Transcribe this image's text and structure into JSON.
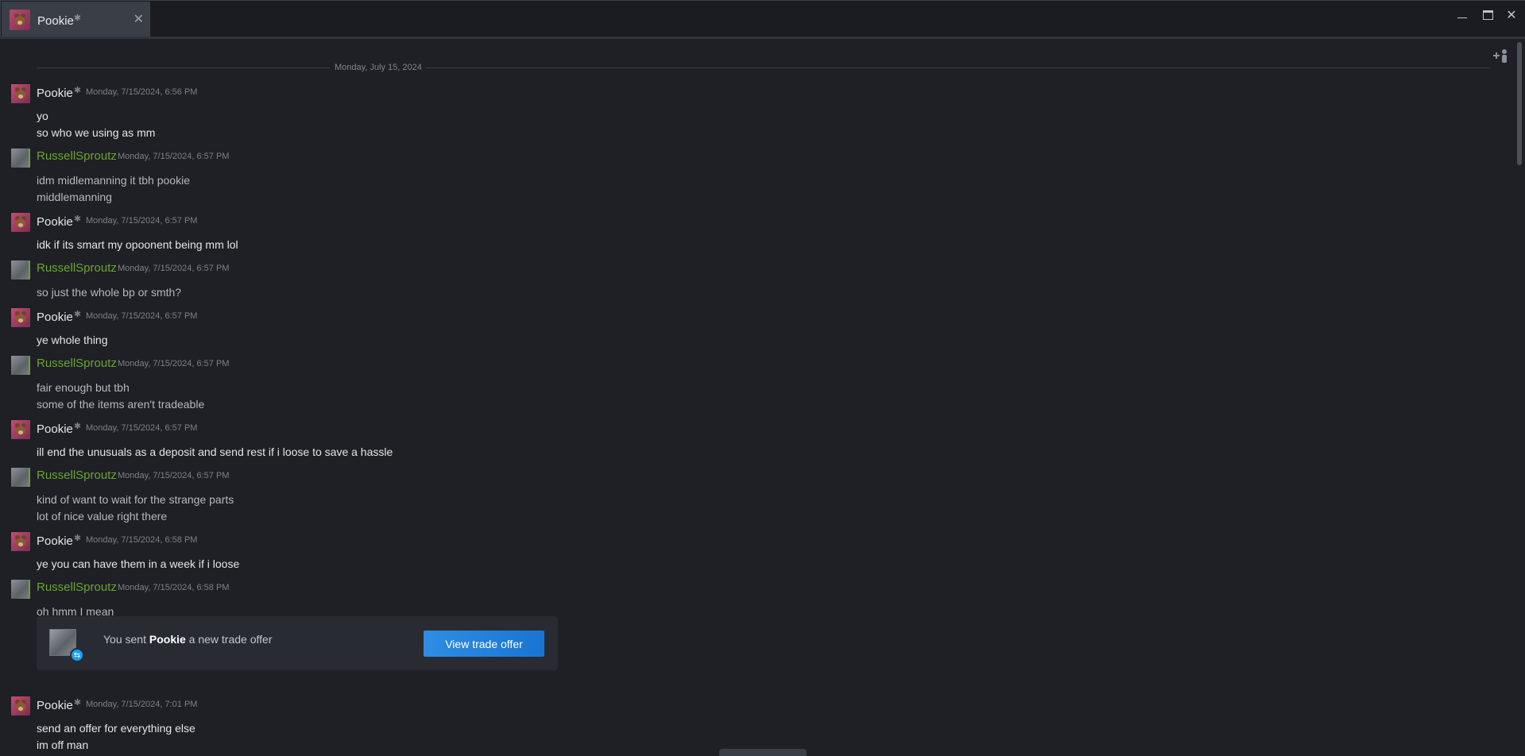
{
  "window": {
    "tab_name": "Pookie",
    "tab_mark": "✱",
    "close_label": "✕",
    "win_close_label": "✕"
  },
  "chat": {
    "date_divider": "Monday, July 15, 2024",
    "messages": [
      {
        "sender": "Pookie",
        "type": "pookie",
        "time": "Monday, 7/15/2024, 6:56 PM",
        "lines": [
          "yo",
          "so who we using as mm"
        ]
      },
      {
        "sender": "RussellSproutz",
        "type": "russell",
        "time": "Monday, 7/15/2024, 6:57 PM",
        "lines": [
          "idm midlemanning it tbh pookie",
          "middlemanning"
        ]
      },
      {
        "sender": "Pookie",
        "type": "pookie",
        "time": "Monday, 7/15/2024, 6:57 PM",
        "lines": [
          "idk if its smart my opoonent being mm lol"
        ]
      },
      {
        "sender": "RussellSproutz",
        "type": "russell",
        "time": "Monday, 7/15/2024, 6:57 PM",
        "lines": [
          "so just the whole bp or smth?"
        ]
      },
      {
        "sender": "Pookie",
        "type": "pookie",
        "time": "Monday, 7/15/2024, 6:57 PM",
        "lines": [
          "ye whole thing"
        ]
      },
      {
        "sender": "RussellSproutz",
        "type": "russell",
        "time": "Monday, 7/15/2024, 6:57 PM",
        "lines": [
          "fair enough but tbh",
          "some of the items aren't tradeable"
        ]
      },
      {
        "sender": "Pookie",
        "type": "pookie",
        "time": "Monday, 7/15/2024, 6:57 PM",
        "lines": [
          "ill end the unusuals as a deposit and send rest if i loose to save a hassle"
        ]
      },
      {
        "sender": "RussellSproutz",
        "type": "russell",
        "time": "Monday, 7/15/2024, 6:57 PM",
        "lines": [
          "kind of want to wait for the strange parts",
          "lot of nice value right there"
        ]
      },
      {
        "sender": "Pookie",
        "type": "pookie",
        "time": "Monday, 7/15/2024, 6:58 PM",
        "lines": [
          "ye you can have them in a week if i loose"
        ]
      },
      {
        "sender": "RussellSproutz",
        "type": "russell",
        "time": "Monday, 7/15/2024, 6:58 PM",
        "lines": [
          "oh hmm I mean"
        ]
      },
      {
        "sender": "Pookie",
        "type": "pookie",
        "time": "Monday, 7/15/2024, 7:01 PM",
        "lines": [
          "send an offer for everything else",
          "im off man"
        ]
      }
    ],
    "trade_offer": {
      "prefix": "You sent",
      "name": "Pookie",
      "suffix": "a new trade offer",
      "button": "View trade offer"
    }
  },
  "colors": {
    "background": "#1e2025",
    "friend_green": "#6aa531",
    "button_blue": "#1a74d2"
  },
  "icons": [
    "minimize-icon",
    "maximize-icon",
    "close-icon",
    "add-friend-icon",
    "bear-avatar-icon",
    "trade-badge-icon"
  ]
}
